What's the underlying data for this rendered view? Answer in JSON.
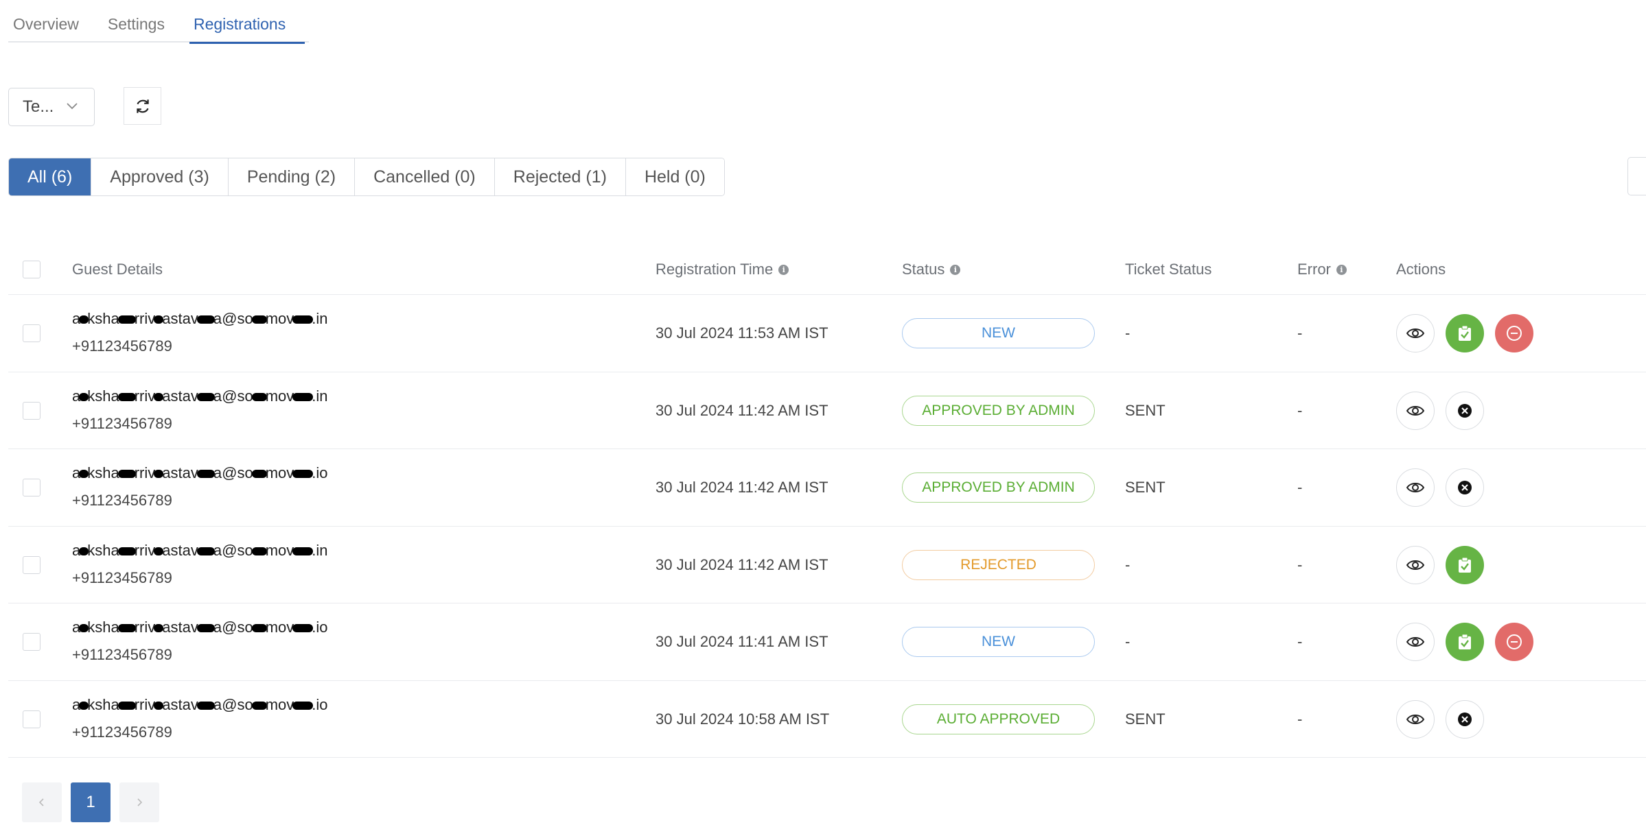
{
  "top_tabs": [
    {
      "label": "Overview",
      "active": false
    },
    {
      "label": "Settings",
      "active": false
    },
    {
      "label": "Registrations",
      "active": true
    }
  ],
  "event_select": {
    "value": "Te..."
  },
  "filter_tabs": [
    {
      "label": "All (6)",
      "active": true
    },
    {
      "label": "Approved (3)",
      "active": false
    },
    {
      "label": "Pending (2)",
      "active": false
    },
    {
      "label": "Cancelled (0)",
      "active": false
    },
    {
      "label": "Rejected (1)",
      "active": false
    },
    {
      "label": "Held (0)",
      "active": false
    }
  ],
  "table": {
    "headers": {
      "guest": "Guest Details",
      "reg_time": "Registration Time",
      "status": "Status",
      "ticket": "Ticket Status",
      "error": "Error",
      "actions": "Actions"
    },
    "rows": [
      {
        "email_parts": [
          "a",
          "ksha",
          "rriv",
          "astav",
          "a@so",
          "mov",
          ".in"
        ],
        "phone": "+91123456789",
        "reg_time": "30 Jul 2024 11:53 AM IST",
        "status": "NEW",
        "status_type": "new",
        "ticket": "-",
        "error": "-",
        "actions": [
          "view",
          "approve",
          "reject"
        ]
      },
      {
        "email_parts": [
          "a",
          "ksha",
          "rriv",
          "astav",
          "a@so",
          "mov",
          ".in"
        ],
        "phone": "+91123456789",
        "reg_time": "30 Jul 2024 11:42 AM IST",
        "status": "APPROVED BY ADMIN",
        "status_type": "approved",
        "ticket": "SENT",
        "error": "-",
        "actions": [
          "view",
          "cancel"
        ]
      },
      {
        "email_parts": [
          "a",
          "ksha",
          "rriv",
          "astav",
          "a@so",
          "mov",
          ".io"
        ],
        "phone": "+91123456789",
        "reg_time": "30 Jul 2024 11:42 AM IST",
        "status": "APPROVED BY ADMIN",
        "status_type": "approved",
        "ticket": "SENT",
        "error": "-",
        "actions": [
          "view",
          "cancel"
        ]
      },
      {
        "email_parts": [
          "a",
          "ksha",
          "rriv",
          "astav",
          "a@so",
          "mov",
          ".in"
        ],
        "phone": "+91123456789",
        "reg_time": "30 Jul 2024 11:42 AM IST",
        "status": "REJECTED",
        "status_type": "rejected",
        "ticket": "-",
        "error": "-",
        "actions": [
          "view",
          "approve"
        ]
      },
      {
        "email_parts": [
          "a",
          "ksha",
          "rriv",
          "astav",
          "a@so",
          "mov",
          ".io"
        ],
        "phone": "+91123456789",
        "reg_time": "30 Jul 2024 11:41 AM IST",
        "status": "NEW",
        "status_type": "new",
        "ticket": "-",
        "error": "-",
        "actions": [
          "view",
          "approve",
          "reject"
        ]
      },
      {
        "email_parts": [
          "a",
          "ksha",
          "rriv",
          "astav",
          "a@so",
          "mov",
          ".io"
        ],
        "phone": "+91123456789",
        "reg_time": "30 Jul 2024 10:58 AM IST",
        "status": "AUTO APPROVED",
        "status_type": "approved",
        "ticket": "SENT",
        "error": "-",
        "actions": [
          "view",
          "cancel"
        ]
      }
    ]
  },
  "pagination": {
    "current": "1",
    "prev_icon": "chevron-left-icon",
    "next_icon": "chevron-right-icon"
  },
  "colors": {
    "primary": "#3e6fb2",
    "approve": "#66b445",
    "reject": "#e26b69",
    "new": "#4a90d9",
    "rejected_text": "#e39a2b"
  }
}
